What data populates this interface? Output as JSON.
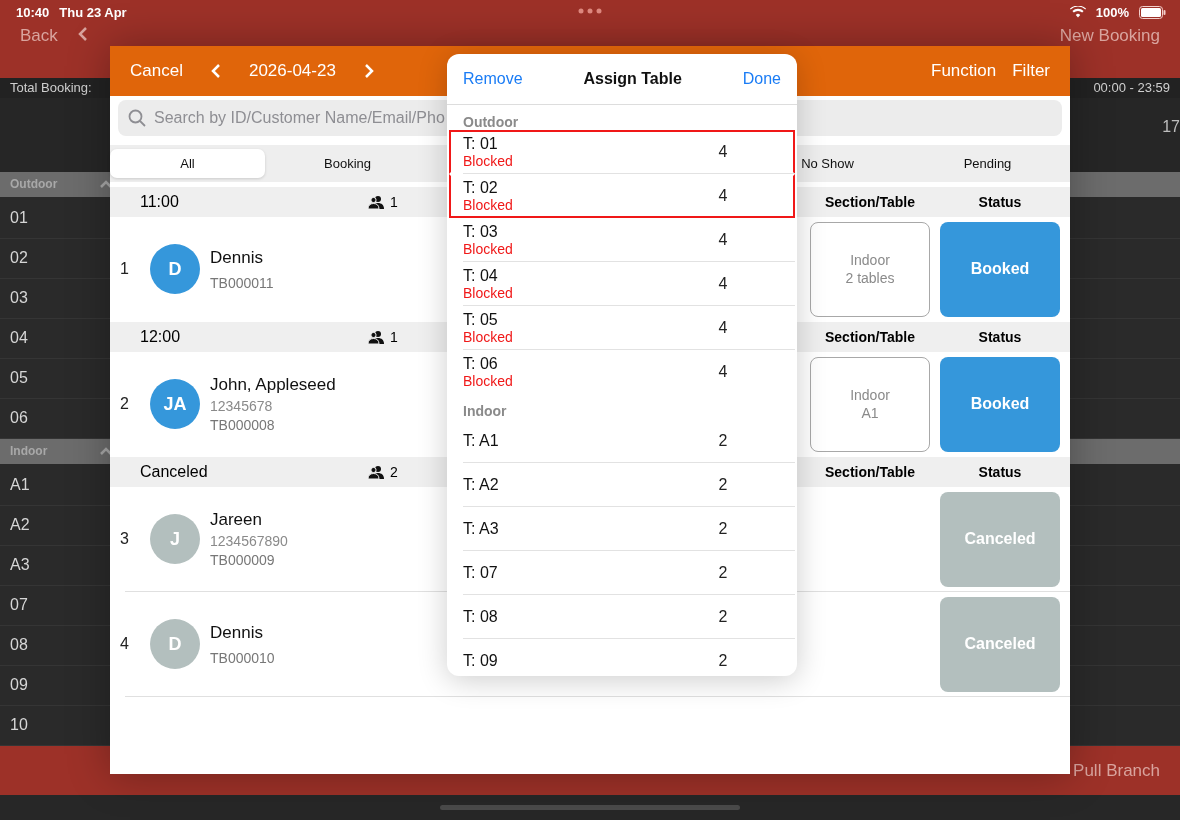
{
  "status_bar": {
    "time": "10:40",
    "date": "Thu 23 Apr",
    "battery": "100%"
  },
  "nav": {
    "back": "Back",
    "action": "New Booking"
  },
  "info_bar": {
    "label": "Total Booking:",
    "time_range": "00:00 - 23:59",
    "count": "17"
  },
  "sidebar": {
    "sections": [
      {
        "name": "Outdoor",
        "expanded": true,
        "tables": [
          "01",
          "02",
          "03",
          "04",
          "05",
          "06"
        ]
      },
      {
        "name": "Indoor",
        "expanded": true,
        "tables": [
          "A1",
          "A2",
          "A3",
          "07",
          "08",
          "09",
          "10"
        ]
      }
    ]
  },
  "bottom_bar": {
    "action": "Pull Branch"
  },
  "sheet": {
    "cancel": "Cancel",
    "date": "2026-04-23",
    "function": "Function",
    "filter": "Filter",
    "search": {
      "placeholder": "Search by ID/Customer Name/Email/Pho"
    },
    "tabs": [
      {
        "label": "All",
        "selected": true
      },
      {
        "label": "Booking",
        "selected": false
      },
      {
        "label": "No Show",
        "selected": false
      },
      {
        "label": "Pending",
        "selected": false
      }
    ],
    "groups": [
      {
        "title": "11:00",
        "pax": "1",
        "section_header": "Section/Table",
        "status_header": "Status",
        "bookings": [
          {
            "index": "1",
            "initials": "D",
            "color": "#3597db",
            "name": "Dennis",
            "code": "TB000011",
            "section": [
              "Indoor",
              "2 tables"
            ],
            "status": "Booked",
            "kind": "booked"
          }
        ]
      },
      {
        "title": "12:00",
        "pax": "1",
        "section_header": "Section/Table",
        "status_header": "Status",
        "bookings": [
          {
            "index": "2",
            "initials": "JA",
            "color": "#3597db",
            "name": "John, Appleseed",
            "phone": "12345678",
            "code": "TB000008",
            "section": [
              "Indoor",
              "A1"
            ],
            "status": "Booked",
            "kind": "booked"
          }
        ]
      },
      {
        "title": "Canceled",
        "pax": "2",
        "section_header": "Section/Table",
        "status_header": "Status",
        "bookings": [
          {
            "index": "3",
            "initials": "J",
            "color": "#b3bfbe",
            "name": "Jareen",
            "phone": "1234567890",
            "code": "TB000009",
            "status": "Canceled",
            "kind": "canceled"
          },
          {
            "index": "4",
            "initials": "D",
            "color": "#b3bfbe",
            "name": "Dennis",
            "code": "TB000010",
            "status": "Canceled",
            "kind": "canceled"
          }
        ]
      }
    ]
  },
  "assign_table": {
    "remove": "Remove",
    "title": "Assign Table",
    "done": "Done",
    "sections": [
      {
        "name": "Outdoor",
        "tables": [
          {
            "label": "T: 01",
            "note": "Blocked",
            "seats": "4",
            "selected": true
          },
          {
            "label": "T: 02",
            "note": "Blocked",
            "seats": "4",
            "selected": true
          },
          {
            "label": "T: 03",
            "note": "Blocked",
            "seats": "4",
            "selected": false
          },
          {
            "label": "T: 04",
            "note": "Blocked",
            "seats": "4",
            "selected": false
          },
          {
            "label": "T: 05",
            "note": "Blocked",
            "seats": "4",
            "selected": false
          },
          {
            "label": "T: 06",
            "note": "Blocked",
            "seats": "4",
            "selected": false
          }
        ]
      },
      {
        "name": "Indoor",
        "tables": [
          {
            "label": "T: A1",
            "seats": "2",
            "selected": false
          },
          {
            "label": "T: A2",
            "seats": "2",
            "selected": false
          },
          {
            "label": "T: A3",
            "seats": "2",
            "selected": false
          },
          {
            "label": "T: 07",
            "seats": "2",
            "selected": false
          },
          {
            "label": "T: 08",
            "seats": "2",
            "selected": false
          },
          {
            "label": "T: 09",
            "seats": "2",
            "selected": false
          }
        ]
      }
    ]
  }
}
